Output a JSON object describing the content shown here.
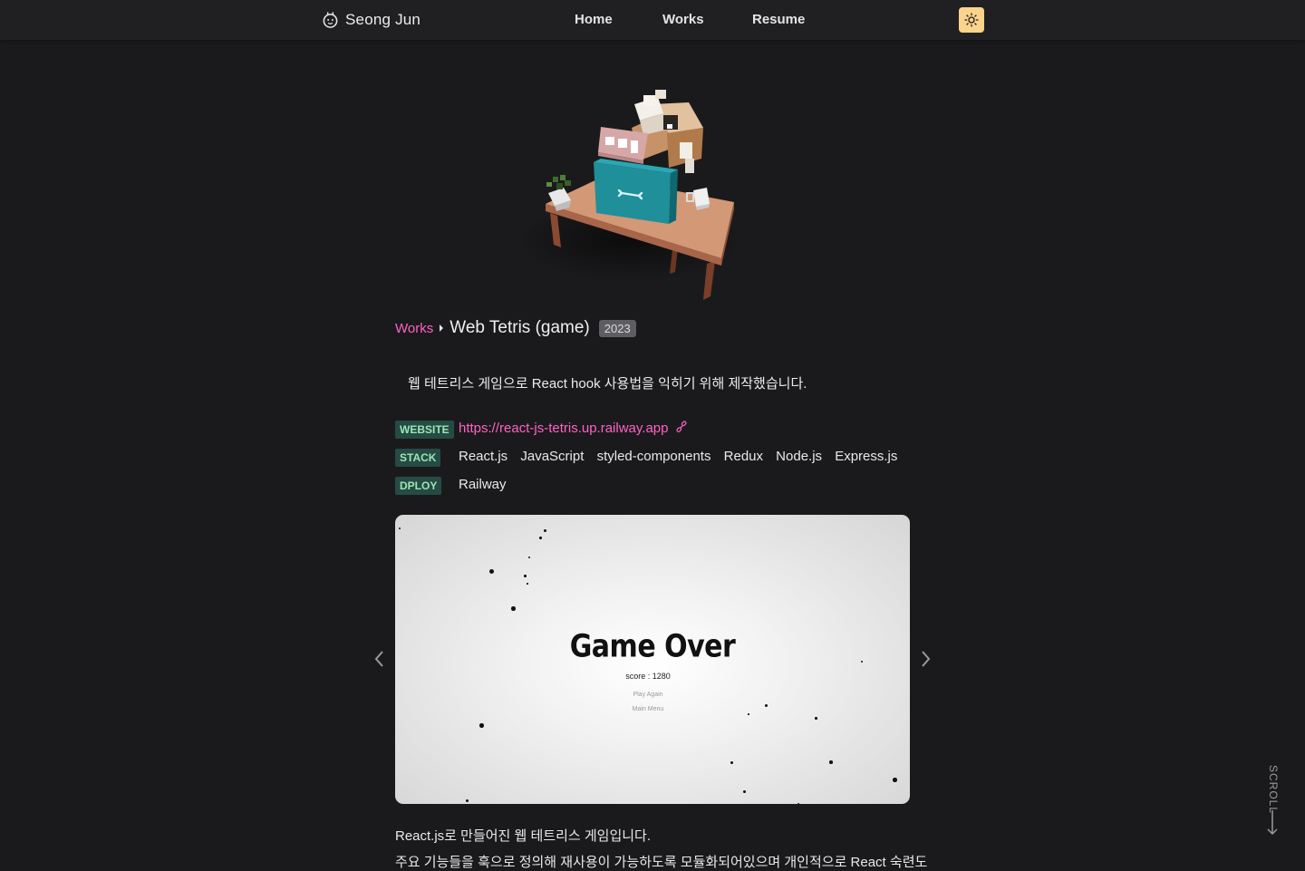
{
  "nav": {
    "brand": "Seong Jun",
    "links": [
      "Home",
      "Works",
      "Resume"
    ]
  },
  "breadcrumb": {
    "parent": "Works",
    "title": "Web Tetris (game)",
    "year": "2023"
  },
  "intro": "웹 테트리스 게임으로 React hook 사용법을 익히기 위해 제작했습니다.",
  "meta": {
    "website_label": "WEBSITE",
    "website_url": "https://react-js-tetris.up.railway.app",
    "stack_label": "STACK",
    "stack": [
      "React.js",
      "JavaScript",
      "styled-components",
      "Redux",
      "Node.js",
      "Express.js"
    ],
    "deploy_label": "DPLOY",
    "deploy": "Railway"
  },
  "screenshot": {
    "title": "Game Over",
    "score": "score : 1280",
    "options": [
      "Play Again",
      "Main Menu"
    ]
  },
  "description": [
    "React.js로 만들어진 웹 테트리스 게임입니다.",
    "주요 기능들을 훅으로 정의해 재사용이 가능하도록 모듈화되어있으며 개인적으로 React 숙련도"
  ],
  "scroll_label": "SCROLL",
  "colors": {
    "accent_pink": "#ff63c3",
    "tag_bg": "#264a44",
    "tag_text": "#9ae6b4",
    "theme_button": "#fbd38d",
    "background": "#1a1a1c"
  },
  "icons": {
    "brand": "face-icon",
    "theme": "sun-icon",
    "link": "link-icon",
    "prev": "chevron-left-icon",
    "next": "chevron-right-icon",
    "scroll": "arrow-down-icon"
  }
}
